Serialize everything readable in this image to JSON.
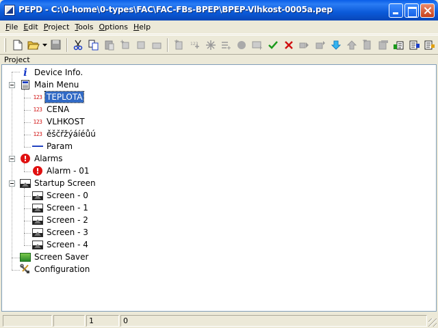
{
  "window": {
    "title": "PEPD - C:\\0-home\\0-types\\FAC\\FAC-FBs-BPEP\\BPEP-Vlhkost-0005a.pep"
  },
  "menu": [
    {
      "label": "File",
      "ul": "F",
      "rest": "ile"
    },
    {
      "label": "Edit",
      "ul": "E",
      "rest": "dit"
    },
    {
      "label": "Project",
      "ul": "P",
      "rest": "roject"
    },
    {
      "label": "Tools",
      "ul": "T",
      "rest": "ools"
    },
    {
      "label": "Options",
      "ul": "O",
      "rest": "ptions"
    },
    {
      "label": "Help",
      "ul": "H",
      "rest": "elp"
    }
  ],
  "toolbar": {
    "icons": [
      "new-file-icon",
      "open-folder-icon",
      "dropdown-arrow-icon",
      "save-icon",
      "cut-icon",
      "copy-icon",
      "paste-icon",
      "add-item-icon",
      "insert-123-icon",
      "delete-item-icon",
      "list-icon",
      "alarm-add-icon",
      "screen-add-icon",
      "check-icon",
      "cancel-icon",
      "move-icon",
      "move-alt-icon",
      "arrow-down-icon",
      "arrow-up-icon",
      "page-icon",
      "page-alt-icon",
      "export-icon",
      "import-icon",
      "build-icon"
    ],
    "accent_check": "#1c9a1c",
    "accent_cancel": "#d01010",
    "accent_arrow": "#1aa0e0"
  },
  "panel": {
    "label": "Project"
  },
  "tree": {
    "device_info": "Device Info.",
    "main_menu": "Main Menu",
    "main_menu_items": [
      {
        "label": "TEPLOTA",
        "icon": "123-icon",
        "selected": true
      },
      {
        "label": "CENA",
        "icon": "123-icon",
        "selected": false
      },
      {
        "label": "VLHKOST",
        "icon": "123-icon",
        "selected": false
      },
      {
        "label": "ěščřžýáíéůú",
        "icon": "123-icon",
        "selected": false
      },
      {
        "label": "Param",
        "icon": "list-icon",
        "selected": false
      }
    ],
    "icon_123_text": "123",
    "alarms": "Alarms",
    "alarm_items": [
      "Alarm - 01"
    ],
    "startup_screen": "Startup Screen",
    "screens": [
      "Screen - 0",
      "Screen - 1",
      "Screen - 2",
      "Screen - 3",
      "Screen - 4"
    ],
    "screen_saver": "Screen Saver",
    "configuration": "Configuration",
    "alarm_glyph": "!",
    "info_glyph": "i"
  },
  "status": {
    "cell1": "",
    "cell2": "",
    "cell3": "1",
    "cell4": "0"
  }
}
